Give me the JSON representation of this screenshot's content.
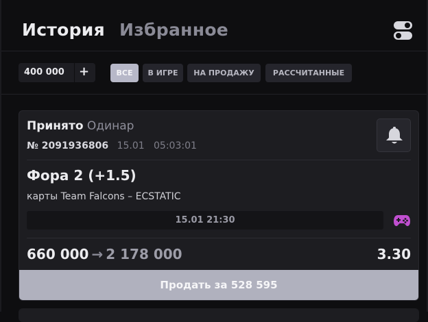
{
  "header": {
    "tabs": [
      {
        "label": "История",
        "active": true
      },
      {
        "label": "Избранное",
        "active": false
      }
    ],
    "toggle_icon": "toggle-switches-icon"
  },
  "filters": {
    "amount": "400 000",
    "plus_label": "+",
    "chips": [
      {
        "label": "ВСЕ",
        "active": true
      },
      {
        "label": "В ИГРЕ",
        "active": false
      },
      {
        "label": "НА ПРОДАЖУ",
        "active": false
      },
      {
        "label": "РАССЧИТАННЫЕ",
        "active": false
      }
    ]
  },
  "bet": {
    "status": "Принято",
    "type": "Одинар",
    "number": "№ 2091936806",
    "datetime": "15.01   05:03:01",
    "market": "Фора 2 (+1.5)",
    "event": "карты Team Falcons – ECSTATIC",
    "start_time": "15.01 21:30",
    "stake": "660 000",
    "arrow": "→",
    "payout": "2 178 000",
    "odds": "3.30",
    "sell_label": "Продать за 528 595",
    "bell_icon": "bell-icon",
    "game_icon": "gamepad-icon"
  },
  "colors": {
    "background": "#0e0e10",
    "card": "#1d1d21",
    "accent_purple": "#c04fd0",
    "chip_active": "#b7b8c8",
    "sell_button": "#b0b1be"
  }
}
